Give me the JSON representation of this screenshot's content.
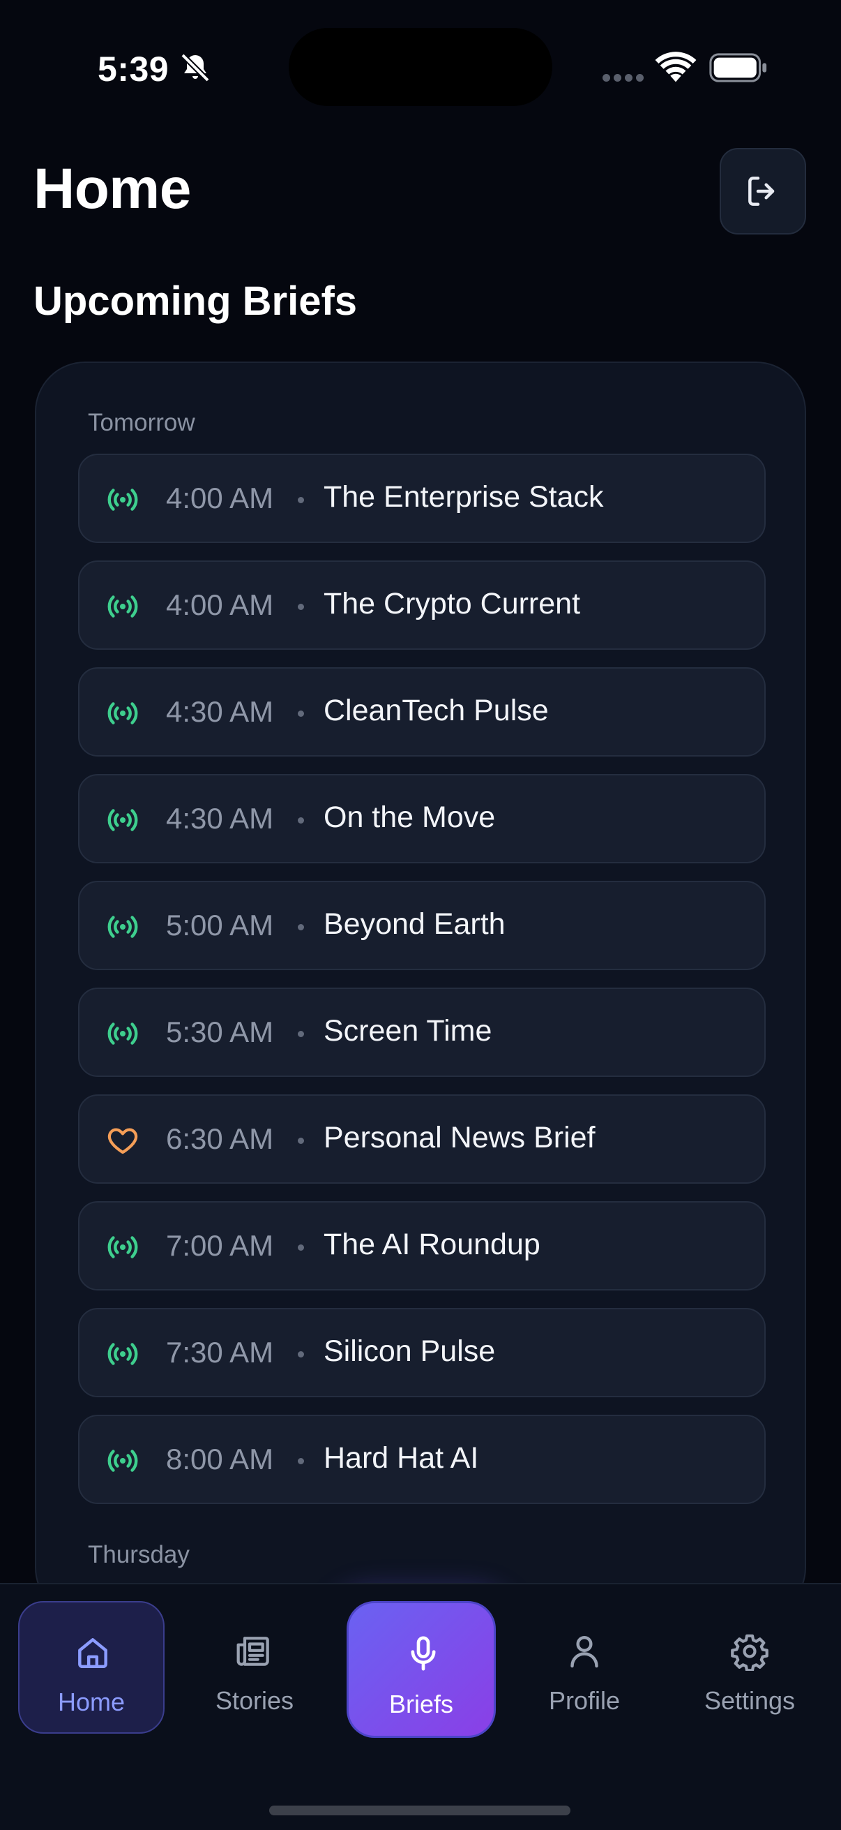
{
  "status_bar": {
    "time": "5:39"
  },
  "header": {
    "title": "Home",
    "section_title": "Upcoming Briefs"
  },
  "colors": {
    "accent_green": "#3ecf8e",
    "accent_orange": "#f59e57",
    "accent_purple": "#7b55ee"
  },
  "days": [
    {
      "label": "Tomorrow",
      "briefs": [
        {
          "icon": "broadcast-icon",
          "time": "4:00 AM",
          "title": "The Enterprise Stack"
        },
        {
          "icon": "broadcast-icon",
          "time": "4:00 AM",
          "title": "The Crypto Current"
        },
        {
          "icon": "broadcast-icon",
          "time": "4:30 AM",
          "title": "CleanTech Pulse"
        },
        {
          "icon": "broadcast-icon",
          "time": "4:30 AM",
          "title": "On the Move"
        },
        {
          "icon": "broadcast-icon",
          "time": "5:00 AM",
          "title": "Beyond Earth"
        },
        {
          "icon": "broadcast-icon",
          "time": "5:30 AM",
          "title": "Screen Time"
        },
        {
          "icon": "heart-icon",
          "time": "6:30 AM",
          "title": "Personal News Brief"
        },
        {
          "icon": "broadcast-icon",
          "time": "7:00 AM",
          "title": "The AI Roundup"
        },
        {
          "icon": "broadcast-icon",
          "time": "7:30 AM",
          "title": "Silicon Pulse"
        },
        {
          "icon": "broadcast-icon",
          "time": "8:00 AM",
          "title": "Hard Hat AI"
        }
      ]
    },
    {
      "label": "Thursday",
      "briefs": []
    }
  ],
  "tabs": [
    {
      "key": "home",
      "label": "Home",
      "icon": "home-icon",
      "active": true
    },
    {
      "key": "stories",
      "label": "Stories",
      "icon": "newspaper-icon",
      "active": false
    },
    {
      "key": "briefs",
      "label": "Briefs",
      "icon": "microphone-icon",
      "active": false
    },
    {
      "key": "profile",
      "label": "Profile",
      "icon": "person-icon",
      "active": false
    },
    {
      "key": "settings",
      "label": "Settings",
      "icon": "gear-icon",
      "active": false
    }
  ]
}
